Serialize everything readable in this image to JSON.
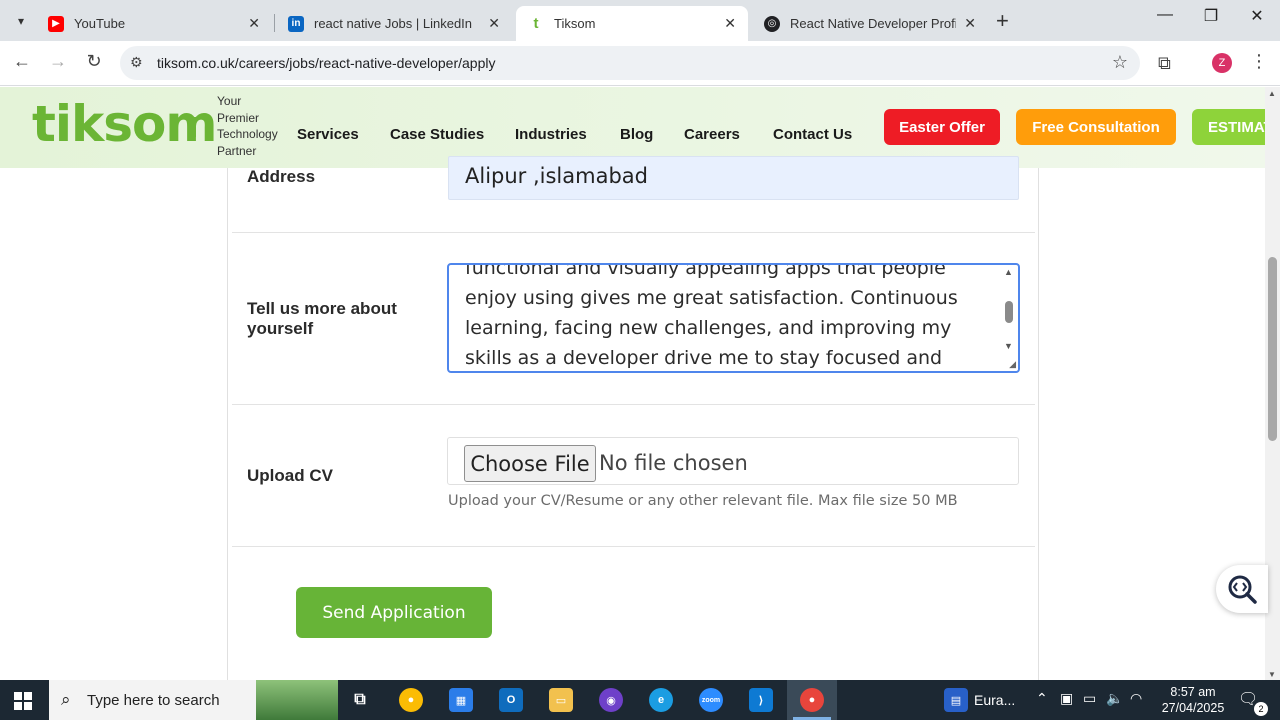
{
  "browser": {
    "tabs": [
      {
        "title": "YouTube",
        "favicon": "youtube-icon",
        "color": "#ff0000",
        "active": false
      },
      {
        "title": "react native Jobs | LinkedIn",
        "favicon": "linkedin-icon",
        "color": "#0a66c2",
        "active": false
      },
      {
        "title": "Tiksom",
        "favicon": "tiksom-icon",
        "color": "#6bb535",
        "active": true
      },
      {
        "title": "React Native Developer Profile",
        "favicon": "openai-icon",
        "color": "#202124",
        "active": false
      }
    ],
    "url": "tiksom.co.uk/careers/jobs/react-native-developer/apply",
    "profile_initial": "Z"
  },
  "site": {
    "logo": "tiksom",
    "tagline": [
      "Your",
      "Premier",
      "Technology",
      "Partner"
    ],
    "nav": [
      "Services",
      "Case Studies",
      "Industries",
      "Blog",
      "Careers",
      "Contact Us"
    ],
    "buttons": {
      "easter": "Easter Offer",
      "consultation": "Free Consultation",
      "estimate": "ESTIMATE"
    },
    "colors": {
      "brand": "#6bb535",
      "easter": "#ee1c25",
      "consultation": "#ff9d0b",
      "estimate": "#8ed33a"
    }
  },
  "form": {
    "address": {
      "label": "Address",
      "value": "Alipur ,islamabad"
    },
    "about": {
      "label_line1": "Tell us more about",
      "label_line2": "yourself",
      "lines": [
        "functional and visually appealing apps that people",
        "enjoy using gives me great satisfaction. Continuous",
        "learning, facing new challenges, and improving my",
        "skills as a developer drive me to stay focused and"
      ]
    },
    "cv": {
      "label": "Upload CV",
      "button": "Choose File",
      "status": "No file chosen",
      "hint": "Upload your CV/Resume or any other relevant file. Max file size 50 MB"
    },
    "submit": "Send Application"
  },
  "taskbar": {
    "search_placeholder": "Type here to search",
    "weather_text": "Eura...",
    "time": "8:57 am",
    "date": "27/04/2025",
    "notifications": "2"
  }
}
